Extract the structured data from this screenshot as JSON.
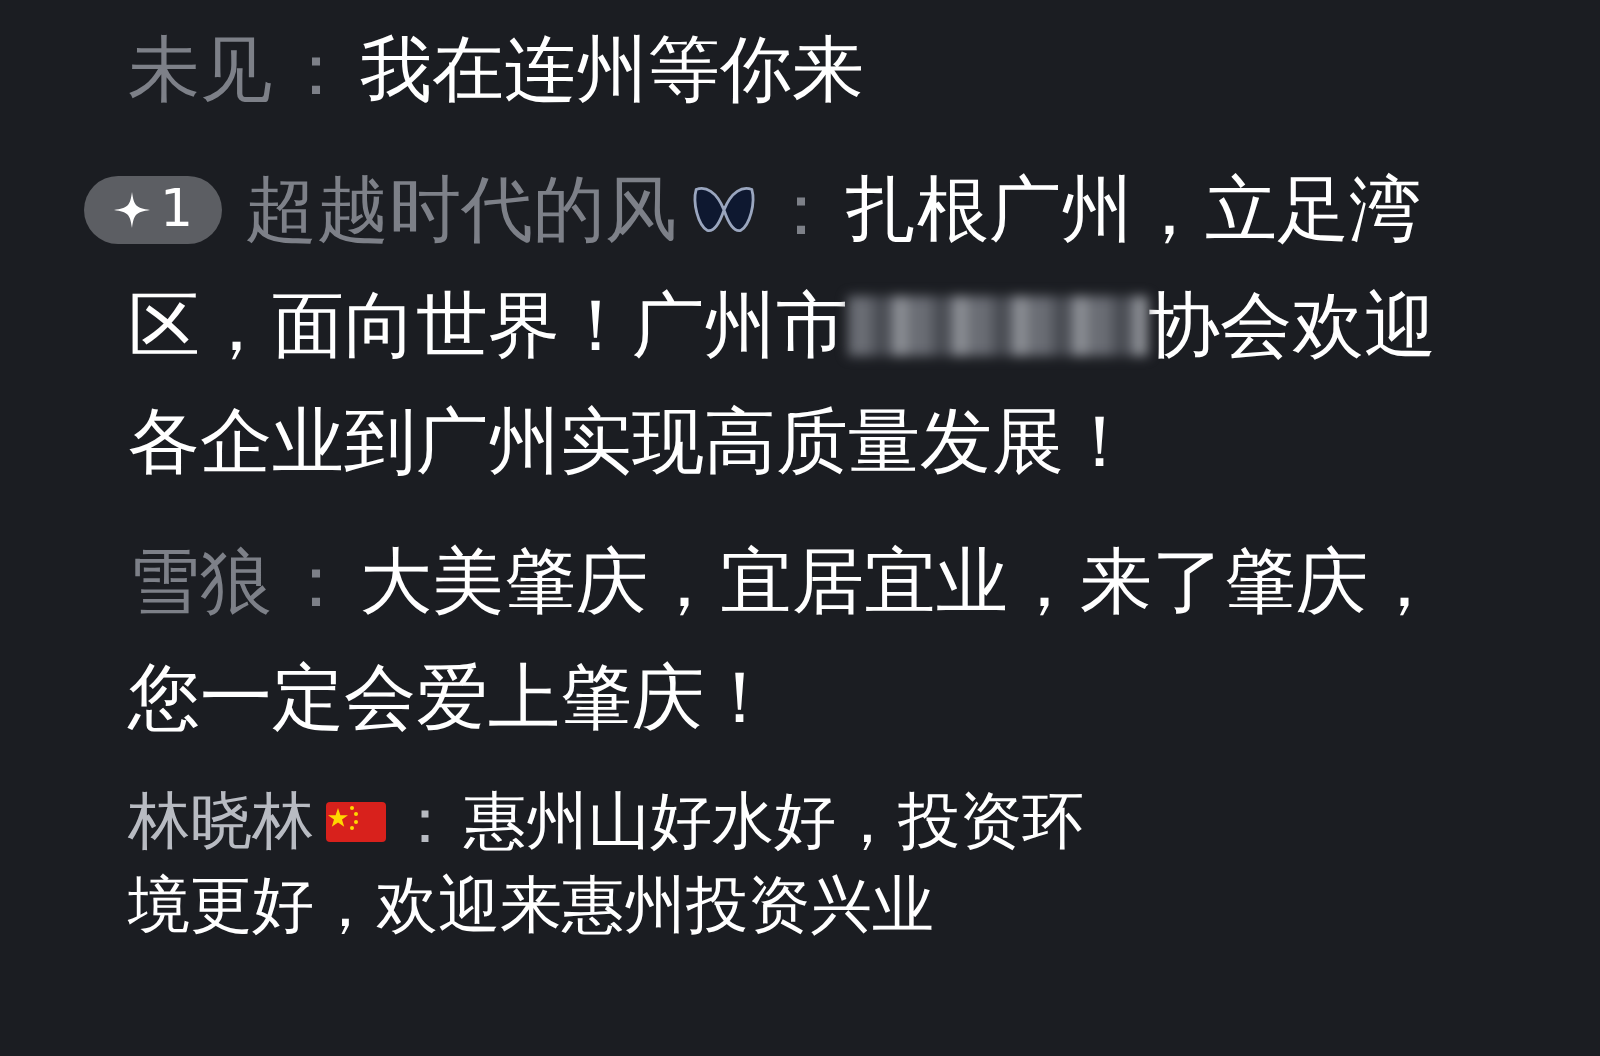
{
  "comments": [
    {
      "kind": "plain",
      "username": "未见",
      "colon": "：",
      "lines": [
        [
          {
            "kind": "text",
            "text": "我在连州等你来"
          }
        ]
      ]
    },
    {
      "kind": "boosted",
      "badge": "1",
      "username": "超越时代的风",
      "colon": "：",
      "lines": [
        [
          {
            "kind": "text",
            "text": "扎根广州，立足湾"
          }
        ],
        [
          {
            "kind": "text",
            "text": "区，面向世界！广州市"
          },
          {
            "kind": "redacted"
          },
          {
            "kind": "text",
            "text": "协会欢迎"
          }
        ],
        [
          {
            "kind": "text",
            "text": "各企业到广州实现高质量发展！"
          }
        ]
      ]
    },
    {
      "kind": "plain",
      "username": "雪狼",
      "colon": "：",
      "lines": [
        [
          {
            "kind": "text",
            "text": "大美肇庆，宜居宜业，来了肇庆，"
          }
        ],
        [
          {
            "kind": "text",
            "text": "您一定会爱上肇庆！"
          }
        ]
      ]
    },
    {
      "kind": "flagged",
      "username": "林晓林",
      "colon": "：",
      "lines": [
        [
          {
            "kind": "text",
            "text": "惠州山好水好，投资环"
          }
        ],
        [
          {
            "kind": "text",
            "text": "境更好，欢迎来惠州投资兴业"
          }
        ]
      ]
    }
  ]
}
